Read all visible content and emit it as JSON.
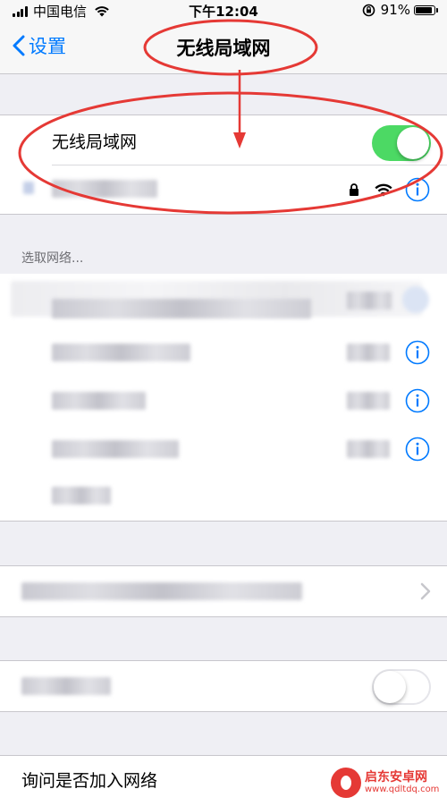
{
  "status_bar": {
    "carrier": "中国电信",
    "time": "下午12:04",
    "battery_percent": "91%",
    "battery_level": 0.91
  },
  "nav": {
    "back_label": "设置",
    "title": "无线局域网"
  },
  "wifi_group": {
    "toggle_label": "无线局域网",
    "toggle_on": true
  },
  "networks": {
    "header": "选取网络..."
  },
  "settings": {
    "ask_to_join_label": "询问是否加入网络"
  },
  "colors": {
    "accent": "#007aff",
    "switch_on": "#4cd964",
    "annotation": "#e53935"
  },
  "watermark": {
    "name": "启东安卓网",
    "url": "www.qdltdq.com"
  }
}
